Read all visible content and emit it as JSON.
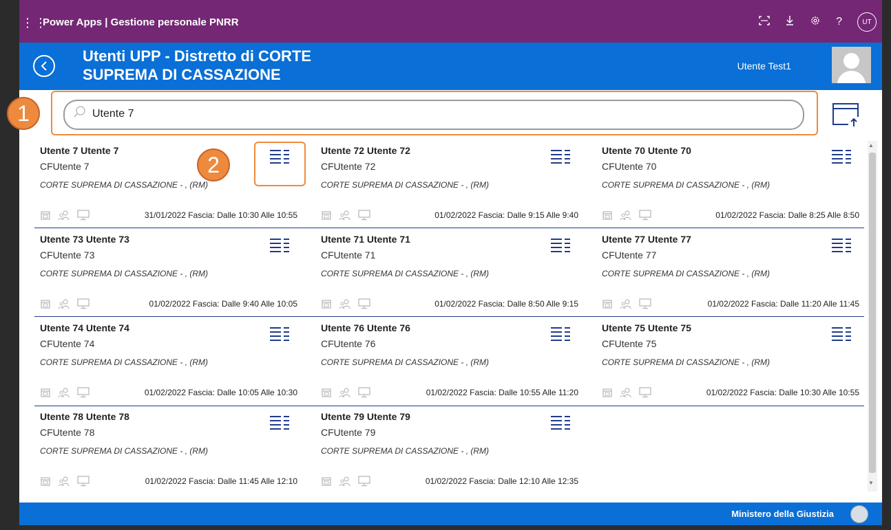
{
  "topbar": {
    "title": "Power Apps  |  Gestione personale PNRR",
    "avatar_initials": "UT",
    "icons": [
      "apps-waffle-icon",
      "fit-screen-icon",
      "download-icon",
      "gear-icon",
      "help-icon"
    ]
  },
  "header": {
    "title_line1": "Utenti UPP - Distretto di CORTE",
    "title_line2": "SUPREMA DI CASSAZIONE",
    "user_name": "Utente Test1"
  },
  "search": {
    "value": "Utente 7",
    "placeholder": ""
  },
  "annotations": {
    "marker1": "1",
    "marker2": "2"
  },
  "cards": [
    {
      "name": "Utente 7 Utente 7",
      "cf": "CFUtente 7",
      "office": "CORTE SUPREMA DI CASSAZIONE - ,  (RM)",
      "slot": "31/01/2022 Fascia: Dalle 10:30 Alle 10:55"
    },
    {
      "name": "Utente 72 Utente 72",
      "cf": "CFUtente 72",
      "office": "CORTE SUPREMA DI CASSAZIONE - ,  (RM)",
      "slot": "01/02/2022 Fascia: Dalle 9:15 Alle 9:40"
    },
    {
      "name": "Utente 70 Utente 70",
      "cf": "CFUtente 70",
      "office": "CORTE SUPREMA DI CASSAZIONE - ,  (RM)",
      "slot": "01/02/2022 Fascia: Dalle 8:25 Alle 8:50"
    },
    {
      "name": "Utente 73 Utente 73",
      "cf": "CFUtente 73",
      "office": "CORTE SUPREMA DI CASSAZIONE - ,  (RM)",
      "slot": "01/02/2022 Fascia: Dalle 9:40 Alle 10:05"
    },
    {
      "name": "Utente 71 Utente 71",
      "cf": "CFUtente 71",
      "office": "CORTE SUPREMA DI CASSAZIONE - ,  (RM)",
      "slot": "01/02/2022 Fascia: Dalle 8:50 Alle 9:15"
    },
    {
      "name": "Utente 77 Utente 77",
      "cf": "CFUtente 77",
      "office": "CORTE SUPREMA DI CASSAZIONE - ,  (RM)",
      "slot": "01/02/2022 Fascia: Dalle 11:20 Alle 11:45"
    },
    {
      "name": "Utente 74 Utente 74",
      "cf": "CFUtente 74",
      "office": "CORTE SUPREMA DI CASSAZIONE - ,  (RM)",
      "slot": "01/02/2022 Fascia: Dalle 10:05 Alle 10:30"
    },
    {
      "name": "Utente 76 Utente 76",
      "cf": "CFUtente 76",
      "office": "CORTE SUPREMA DI CASSAZIONE - ,  (RM)",
      "slot": "01/02/2022 Fascia: Dalle 10:55 Alle 11:20"
    },
    {
      "name": "Utente 75 Utente 75",
      "cf": "CFUtente 75",
      "office": "CORTE SUPREMA DI CASSAZIONE - ,  (RM)",
      "slot": "01/02/2022 Fascia: Dalle 10:30 Alle 10:55"
    },
    {
      "name": "Utente 78 Utente 78",
      "cf": "CFUtente 78",
      "office": "CORTE SUPREMA DI CASSAZIONE - ,  (RM)",
      "slot": "01/02/2022 Fascia: Dalle 11:45 Alle 12:10"
    },
    {
      "name": "Utente 79 Utente 79",
      "cf": "CFUtente 79",
      "office": "CORTE SUPREMA DI CASSAZIONE - ,  (RM)",
      "slot": "01/02/2022 Fascia: Dalle 12:10 Alle 12:35"
    }
  ],
  "card_icons": [
    "calendar-icon",
    "people-icon",
    "monitor-icon",
    "details-list-icon"
  ],
  "footer": {
    "ministry": "Ministero della Giustizia"
  },
  "colors": {
    "topbar": "#742774",
    "header": "#0a6fd6",
    "accent_icon": "#1f3a8a",
    "annotation": "#ee8a3d"
  }
}
